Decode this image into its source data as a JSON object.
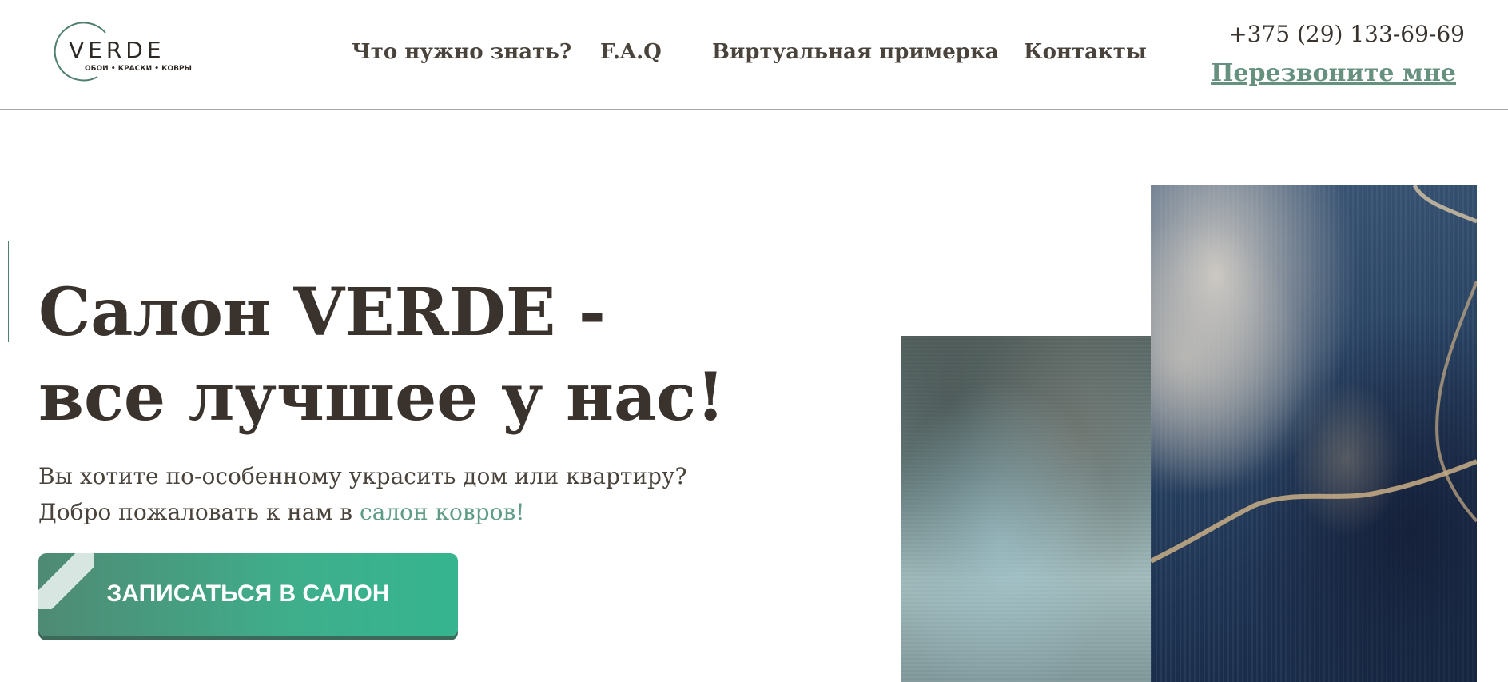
{
  "logo": {
    "word": "VERDE",
    "tagline": "ОБОИ • КРАСКИ • КОВРЫ",
    "ring_color": "#4f7f6f"
  },
  "nav": {
    "items": [
      {
        "label": "Что нужно знать?"
      },
      {
        "label": "F.A.Q"
      },
      {
        "label": "Виртуальная примерка"
      },
      {
        "label": "Контакты"
      }
    ]
  },
  "contact": {
    "phone": "+375 (29) 133-69-69",
    "callback_label": "Перезвоните мне"
  },
  "hero": {
    "title_line1": "Салон VERDE -",
    "title_line2": "все лучшее у нас!",
    "subtitle_line1": "Вы хотите по-особенному украсить дом или квартиру?",
    "subtitle_line2_prefix": "Добро пожаловать к нам в ",
    "subtitle_line2_link": "салон ковров!",
    "cta_label": "ЗАПИСАТЬСЯ В САЛОН"
  },
  "colors": {
    "accent": "#5f9c86",
    "button_start": "#4f8a74",
    "button_end": "#35b58f",
    "text": "#3a332d"
  }
}
